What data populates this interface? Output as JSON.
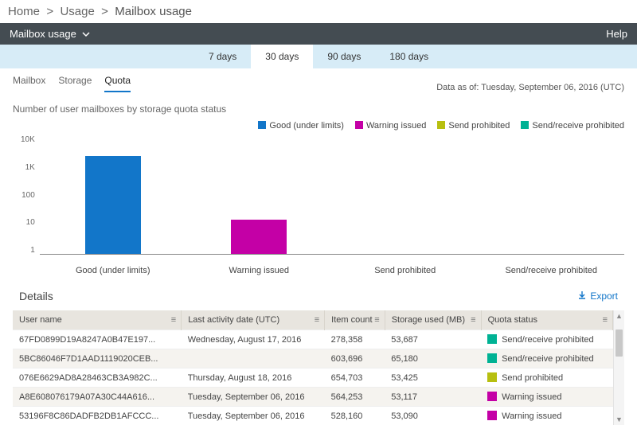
{
  "breadcrumb": {
    "root": "Home",
    "mid": "Usage",
    "leaf": "Mailbox usage"
  },
  "header": {
    "title": "Mailbox usage",
    "help": "Help"
  },
  "periods": {
    "items": [
      "7 days",
      "30 days",
      "90 days",
      "180 days"
    ],
    "activeIndex": 1
  },
  "viewTabs": {
    "items": [
      "Mailbox",
      "Storage",
      "Quota"
    ],
    "activeIndex": 2
  },
  "asof": "Data as of: Tuesday, September 06, 2016 (UTC)",
  "subtitle": "Number of user mailboxes by storage quota status",
  "legend": [
    {
      "label": "Good (under limits)",
      "colorClass": "c-blue"
    },
    {
      "label": "Warning issued",
      "colorClass": "c-mag"
    },
    {
      "label": "Send prohibited",
      "colorClass": "c-olive"
    },
    {
      "label": "Send/receive prohibited",
      "colorClass": "c-teal"
    }
  ],
  "chart_data": {
    "type": "bar",
    "categories": [
      "Good (under limits)",
      "Warning issued",
      "Send prohibited",
      "Send/receive prohibited"
    ],
    "values": [
      2000,
      14,
      0,
      0
    ],
    "title": "Number of user mailboxes by storage quota status",
    "xlabel": "",
    "ylabel": "",
    "yscale": "log",
    "yticks": [
      "10K",
      "1K",
      "100",
      "10",
      "1"
    ],
    "ylim": [
      1,
      10000
    ],
    "colors": [
      "#1276c9",
      "#c400a6",
      "#b7bf10",
      "#00b294"
    ]
  },
  "details": {
    "title": "Details",
    "export": "Export",
    "columns": [
      "User name",
      "Last activity date (UTC)",
      "Item count",
      "Storage used (MB)",
      "Quota status"
    ],
    "rows": [
      {
        "user": "67FD0899D19A8247A0B47E197...",
        "date": "Wednesday, August 17, 2016",
        "items": "278,358",
        "storage": "53,687",
        "status": "Send/receive prohibited",
        "statusColor": "c-teal"
      },
      {
        "user": "5BC86046F7D1AAD1119020CEB...",
        "date": "",
        "items": "603,696",
        "storage": "65,180",
        "status": "Send/receive prohibited",
        "statusColor": "c-teal"
      },
      {
        "user": "076E6629AD8A28463CB3A982C...",
        "date": "Thursday, August 18, 2016",
        "items": "654,703",
        "storage": "53,425",
        "status": "Send prohibited",
        "statusColor": "c-olive"
      },
      {
        "user": "A8E608076179A07A30C44A616...",
        "date": "Tuesday, September 06, 2016",
        "items": "564,253",
        "storage": "53,117",
        "status": "Warning issued",
        "statusColor": "c-mag"
      },
      {
        "user": "53196F8C86DADFB2DB1AFCCC...",
        "date": "Tuesday, September 06, 2016",
        "items": "528,160",
        "storage": "53,090",
        "status": "Warning issued",
        "statusColor": "c-mag"
      }
    ]
  }
}
